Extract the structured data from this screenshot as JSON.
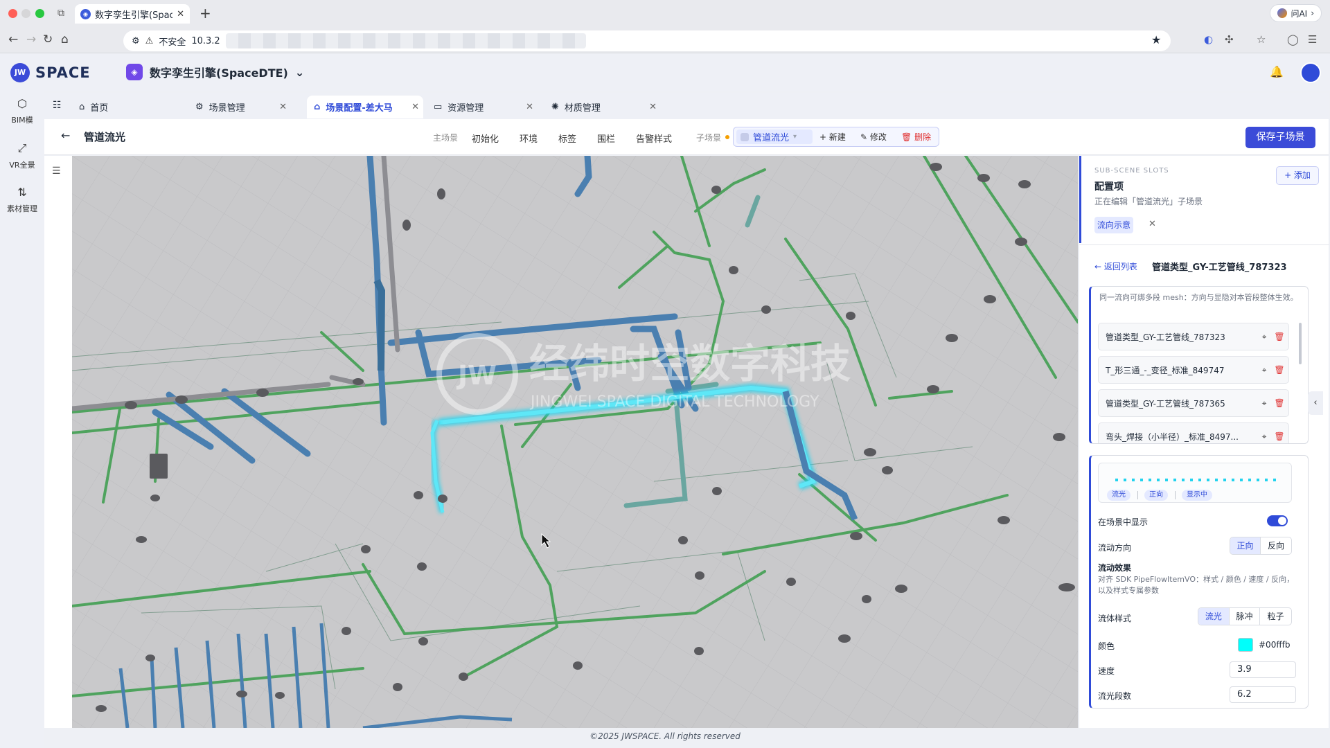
{
  "browser": {
    "tab_title": "数字孪生引擎(SpaceDTE)",
    "tab_close": "✕",
    "new_tab": "+",
    "security_label": "不安全",
    "url_prefix": "10.3.2",
    "ask_ai": "问AI",
    "ask_ai_chevron": "›"
  },
  "app": {
    "logo_text": "SPACE",
    "logo_mark": "JW",
    "project_title": "数字孪生引擎(SpaceDTE)",
    "project_chevron": "⌄",
    "brand_color": "#3b4bd8"
  },
  "rail": [
    {
      "label": "BIM模",
      "icon": "cube-icon"
    },
    {
      "label": "VR全景",
      "icon": "vr-icon"
    },
    {
      "label": "素材管理",
      "icon": "asset-icon"
    }
  ],
  "tabs": [
    {
      "label": "首页",
      "icon": "home-icon",
      "closable": false
    },
    {
      "label": "场景管理",
      "icon": "gear-icon",
      "closable": true
    },
    {
      "label": "场景配置-差大马",
      "icon": "home-icon",
      "closable": true,
      "active": true
    },
    {
      "label": "资源管理",
      "icon": "monitor-icon",
      "closable": true
    },
    {
      "label": "材质管理",
      "icon": "palette-icon",
      "closable": true
    }
  ],
  "toolbar": {
    "page_title": "管道流光",
    "main_scene_label": "主场景",
    "items": [
      "初始化",
      "环境",
      "标签",
      "围栏",
      "告警样式"
    ],
    "sub_scene_label": "子场景",
    "sub_scene_value": "管道流光",
    "new_label": "+ 新建",
    "edit_label": "✎ 修改",
    "delete_label": "🗑 删除",
    "save_label": "保存子场景"
  },
  "scene": {
    "watermark_cn": "经纬时空数字科技",
    "watermark_en": "JINGWEI SPACE DIGITAL TECHNOLOGY",
    "glow_color": "#22d3ee"
  },
  "panel": {
    "slots_label": "SUB-SCENE SLOTS",
    "title": "配置项",
    "subtitle": "正在编辑「管道流光」子场景",
    "add_label": "+ 添加",
    "chip_label": "流向示意",
    "chip_close": "✕",
    "back_label": "← 返回列表",
    "detail_title": "管道类型_GY-工艺管线_787323",
    "mesh_note": "同一流向可绑多段 mesh：方向与显隐对本管段整体生效。",
    "mesh_items": [
      "管道类型_GY-工艺管线_787323",
      "T_形三通_-_变径_标准_849747",
      "管道类型_GY-工艺管线_787365",
      "弯头_焊接（小半径）_标准_8497..."
    ],
    "edge_toggle": "‹",
    "preview_badges": [
      "流光",
      "正向",
      "显示中"
    ],
    "show_in_scene_label": "在场景中显示",
    "show_in_scene": true,
    "direction_label": "流动方向",
    "direction_options": [
      "正向",
      "反向"
    ],
    "direction_selected": "正向",
    "effect_title": "流动效果",
    "effect_note": "对齐 SDK PipeFlowItemVO：样式 / 颜色 / 速度 / 反向，以及样式专属参数",
    "style_label": "流体样式",
    "style_options": [
      "流光",
      "脉冲",
      "粒子"
    ],
    "style_selected": "流光",
    "color_label": "颜色",
    "color_value": "#00fffb",
    "speed_label": "速度",
    "speed_value": "3.9",
    "segments_label": "流光段数",
    "segments_value": "6.2"
  },
  "footer": "©2025 JWSPACE. All rights reserved"
}
